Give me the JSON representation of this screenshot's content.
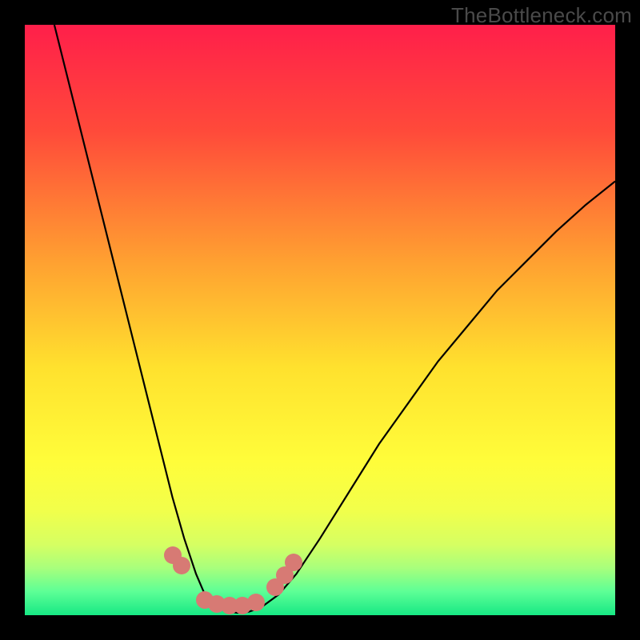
{
  "watermark": "TheBottleneck.com",
  "chart_data": {
    "type": "line",
    "title": "",
    "xlabel": "",
    "ylabel": "",
    "xlim": [
      0,
      100
    ],
    "ylim": [
      0,
      100
    ],
    "gradient_stops": [
      {
        "pct": 0,
        "color": "#ff1f4a"
      },
      {
        "pct": 18,
        "color": "#ff4a3a"
      },
      {
        "pct": 40,
        "color": "#ffa031"
      },
      {
        "pct": 58,
        "color": "#ffe12e"
      },
      {
        "pct": 74,
        "color": "#fffd3a"
      },
      {
        "pct": 82,
        "color": "#f2ff4a"
      },
      {
        "pct": 88,
        "color": "#d6ff62"
      },
      {
        "pct": 92,
        "color": "#a8ff7c"
      },
      {
        "pct": 96,
        "color": "#5dff96"
      },
      {
        "pct": 100,
        "color": "#17e884"
      }
    ],
    "series": [
      {
        "name": "bottleneck-curve",
        "x": [
          5,
          7,
          9,
          11,
          13,
          15,
          17,
          19,
          21,
          23,
          25,
          27,
          29,
          30.5,
          32,
          34,
          36,
          38,
          40,
          43,
          46,
          50,
          55,
          60,
          65,
          70,
          75,
          80,
          85,
          90,
          95,
          100
        ],
        "y": [
          100,
          92,
          84,
          76,
          68,
          60,
          52,
          44,
          36,
          28,
          20,
          13,
          7,
          3.5,
          1.5,
          0.7,
          0.4,
          0.6,
          1.3,
          3.5,
          7,
          13,
          21,
          29,
          36,
          43,
          49,
          55,
          60,
          65,
          69.5,
          73.5
        ]
      }
    ],
    "markers": [
      {
        "x": 25.0,
        "y": 10.2
      },
      {
        "x": 26.5,
        "y": 8.4
      },
      {
        "x": 30.5,
        "y": 2.6
      },
      {
        "x": 32.5,
        "y": 1.9
      },
      {
        "x": 34.7,
        "y": 1.6
      },
      {
        "x": 36.8,
        "y": 1.6
      },
      {
        "x": 39.2,
        "y": 2.2
      },
      {
        "x": 42.4,
        "y": 4.8
      },
      {
        "x": 44.0,
        "y": 6.8
      },
      {
        "x": 45.5,
        "y": 8.9
      }
    ],
    "marker_color": "#d77a74",
    "curve_color": "#000000"
  }
}
